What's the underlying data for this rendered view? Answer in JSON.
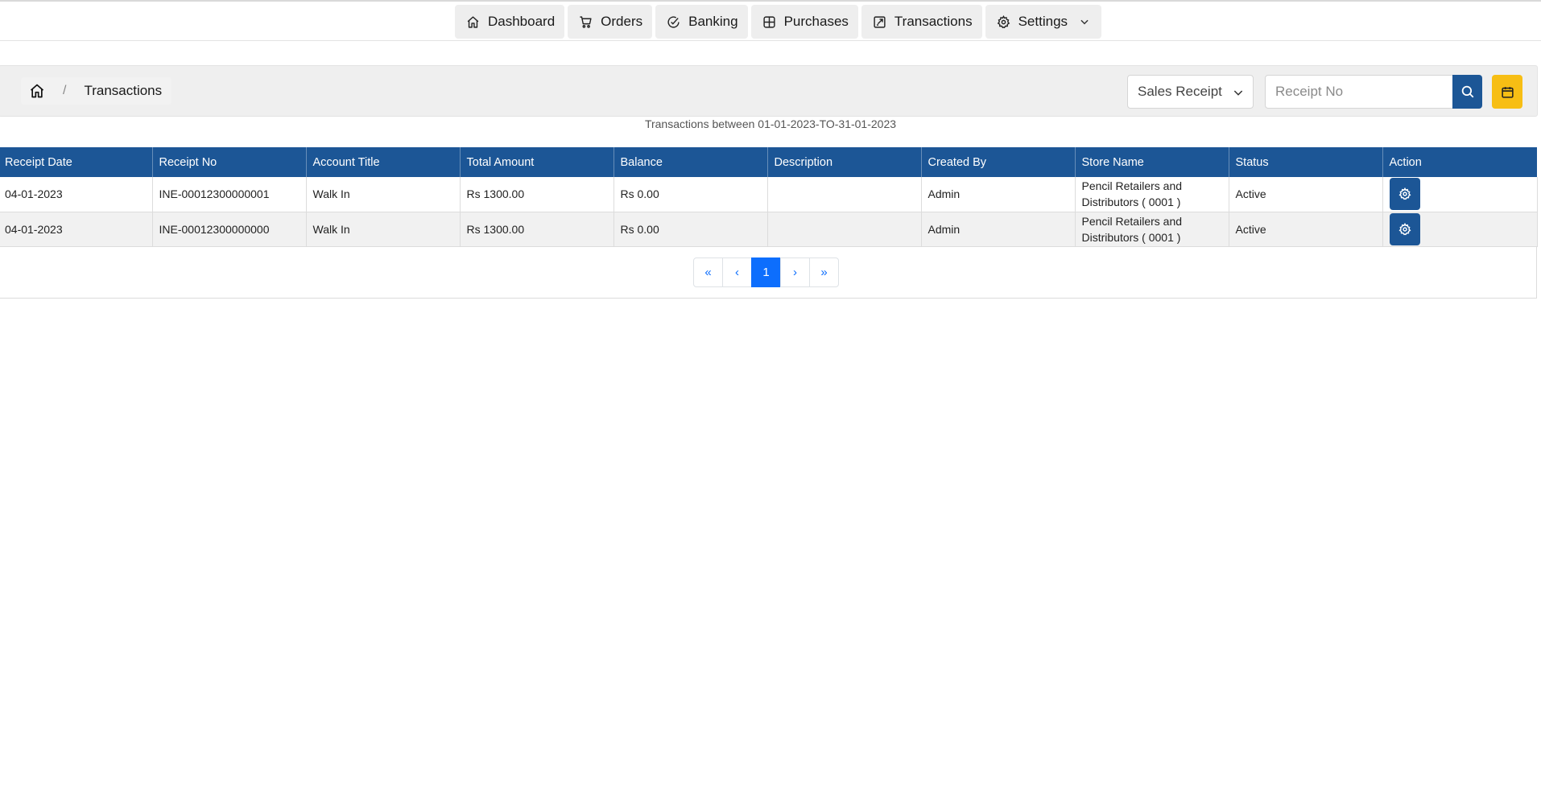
{
  "nav": {
    "items": [
      {
        "label": "Dashboard",
        "icon": "home-icon"
      },
      {
        "label": "Orders",
        "icon": "cart-icon"
      },
      {
        "label": "Banking",
        "icon": "check-circle-icon"
      },
      {
        "label": "Purchases",
        "icon": "grid-icon"
      },
      {
        "label": "Transactions",
        "icon": "external-link-icon"
      },
      {
        "label": "Settings",
        "icon": "gear-icon"
      }
    ]
  },
  "breadcrumb": {
    "separator": "/",
    "current": "Transactions"
  },
  "filters": {
    "type_selected": "Sales Receipt",
    "search_placeholder": "Receipt No"
  },
  "caption": "Transactions between 01-01-2023-TO-31-01-2023",
  "table": {
    "columns": [
      "Receipt Date",
      "Receipt No",
      "Account Title",
      "Total Amount",
      "Balance",
      "Description",
      "Created By",
      "Store Name",
      "Status",
      "Action"
    ],
    "rows": [
      {
        "date": "04-01-2023",
        "receipt_no": "INE-00012300000001",
        "account": "Walk In",
        "total": "Rs 1300.00",
        "balance": "Rs 0.00",
        "description": "",
        "created_by": "Admin",
        "store_line1": "Pencil Retailers and",
        "store_line2": "Distributors ( 0001 )",
        "status": "Active"
      },
      {
        "date": "04-01-2023",
        "receipt_no": "INE-00012300000000",
        "account": "Walk In",
        "total": "Rs 1300.00",
        "balance": "Rs 0.00",
        "description": "",
        "created_by": "Admin",
        "store_line1": "Pencil Retailers and",
        "store_line2": "Distributors ( 0001 )",
        "status": "Active"
      }
    ]
  },
  "pagination": {
    "first": "«",
    "prev": "‹",
    "current": "1",
    "next": "›",
    "last": "»"
  },
  "colors": {
    "primary": "#1c5696",
    "accent": "#f7be14",
    "page_active": "#0d6efd"
  }
}
